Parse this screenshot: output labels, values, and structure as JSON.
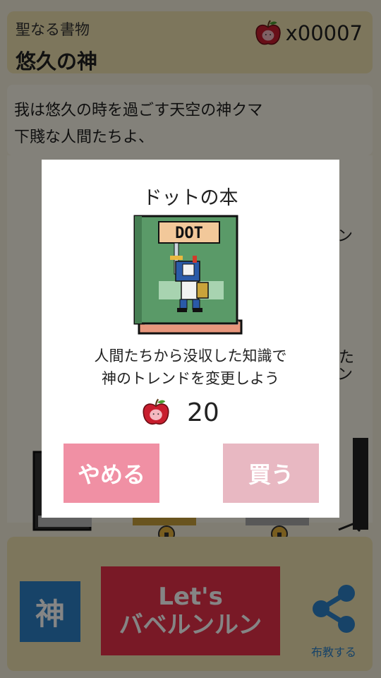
{
  "header": {
    "subtitle": "聖なる書物",
    "title": "悠久の神",
    "apple_count": "x00007"
  },
  "story": {
    "text": "我は悠久の時を過ごす天空の神クマ\n下賤な人間たちよ、\n神話を語り継ぐものが現れし\n破壊の"
  },
  "fragments": [
    "ン",
    "た",
    "ン"
  ],
  "bottom": {
    "kami_label": "神",
    "lets_line1": "Let's",
    "lets_line2": "バベルンルン",
    "share_label": "布教する"
  },
  "modal": {
    "title": "ドットの本",
    "book_label": "DOT",
    "description": "人間たちから没収した知識で\n神のトレンドを変更しよう",
    "price": "20",
    "cancel_label": "やめる",
    "buy_label": "買う"
  },
  "colors": {
    "accent_red": "#e8304a",
    "accent_blue": "#2c80c8",
    "panel": "#efe2b0"
  }
}
